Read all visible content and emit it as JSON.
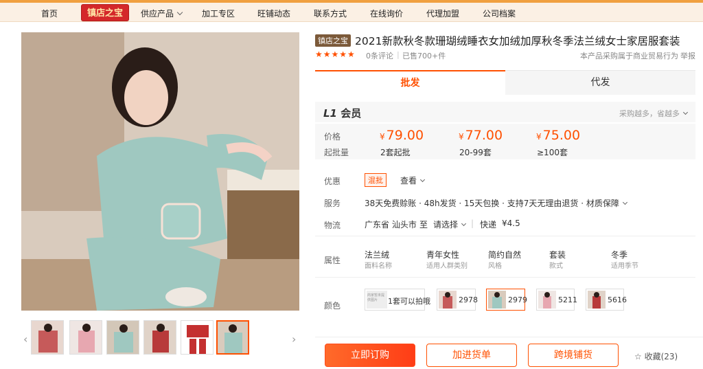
{
  "nav": {
    "home": "首页",
    "badge": "镇店之宝",
    "supply": "供应产品",
    "processing": "加工专区",
    "news": "旺铺动态",
    "contact": "联系方式",
    "inquiry": "在线询价",
    "agent": "代理加盟",
    "archive": "公司档案"
  },
  "product": {
    "tag": "镇店之宝",
    "title": "2021新款秋冬款珊瑚绒睡衣女加绒加厚秋冬季法兰绒女士家居服套装",
    "rating_stars": 5,
    "reviews": "0条评论",
    "sold": "已售700+件",
    "purchase_note": "本产品采购属于商业贸易行为",
    "report": "举报"
  },
  "tabs": {
    "wholesale": "批发",
    "dropship": "代发"
  },
  "member": {
    "level": "L1",
    "label": "会员",
    "more": "采购越多，省越多"
  },
  "pricing": {
    "price_label": "价格",
    "moq_label": "起批量",
    "currency": "¥",
    "tiers": [
      {
        "price": "79.00",
        "qty": "2套起批"
      },
      {
        "price": "77.00",
        "qty": "20-99套"
      },
      {
        "price": "75.00",
        "qty": "≥100套"
      }
    ]
  },
  "offers": {
    "discount_label": "优惠",
    "discount_badge": "混批",
    "discount_view": "查看",
    "service_label": "服务",
    "service_text": "38天免费赊账 · 48h发货 · 15天包换 · 支持7天无理由退货 · 材质保障",
    "logistics_label": "物流",
    "origin": "广东省 汕头市",
    "to": "至",
    "dest": "请选择",
    "express": "快递",
    "fee": "¥4.5"
  },
  "attributes": {
    "label": "属性",
    "items": [
      {
        "value": "法兰绒",
        "name": "面料名称"
      },
      {
        "value": "青年女性",
        "name": "适用人群类别"
      },
      {
        "value": "简约自然",
        "name": "风格"
      },
      {
        "value": "套装",
        "name": "款式"
      },
      {
        "value": "冬季",
        "name": "适用季节"
      }
    ]
  },
  "colors": {
    "label": "颜色",
    "placeholder_img": "商家暂未提供图片",
    "items": [
      "1套可以拍哦",
      "2978",
      "2979",
      "5211",
      "5616"
    ]
  },
  "actions": {
    "buy": "立即订购",
    "cart": "加进货单",
    "crossborder": "跨境铺货",
    "favorite": "收藏(23)"
  },
  "colors_theme": {
    "accent": "#ff5000",
    "nav_bg": "#fbf0e4",
    "badge": "#d4282a"
  }
}
